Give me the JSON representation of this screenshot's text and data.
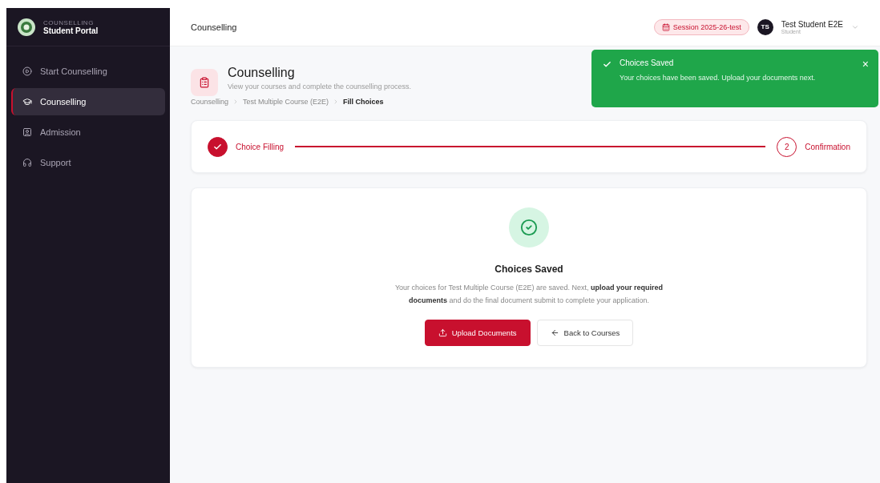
{
  "sidebar": {
    "brand_caption": "COUNSELLING",
    "brand_title": "Student Portal",
    "items": [
      {
        "label": "Start Counselling",
        "selected": false
      },
      {
        "label": "Counselling",
        "selected": true
      },
      {
        "label": "Admission",
        "selected": false
      },
      {
        "label": "Support",
        "selected": false
      }
    ]
  },
  "header": {
    "title": "Counselling",
    "session": "Session 2025-26-test",
    "user": {
      "initials": "TS",
      "name": "Test Student E2E",
      "role": "Student"
    }
  },
  "page": {
    "title": "Counselling",
    "subtitle": "View your courses and complete the counselling process.",
    "breadcrumb": [
      "Counselling",
      "Test Multiple Course (E2E)",
      "Fill Choices"
    ]
  },
  "steps": [
    {
      "label": "Choice Filling",
      "done": true
    },
    {
      "number": "2",
      "label": "Confirmation",
      "done": false
    }
  ],
  "result": {
    "title": "Choices Saved",
    "text": "Your choices for Test Multiple Course (E2E) are saved. Next, **upload your required documents** and do the final document submit to complete your application.",
    "primary_button": "Upload Documents",
    "secondary_button": "Back to Courses"
  },
  "toast": {
    "title": "Choices Saved",
    "message": "Your choices have been saved. Upload your documents next.",
    "close": "×"
  }
}
